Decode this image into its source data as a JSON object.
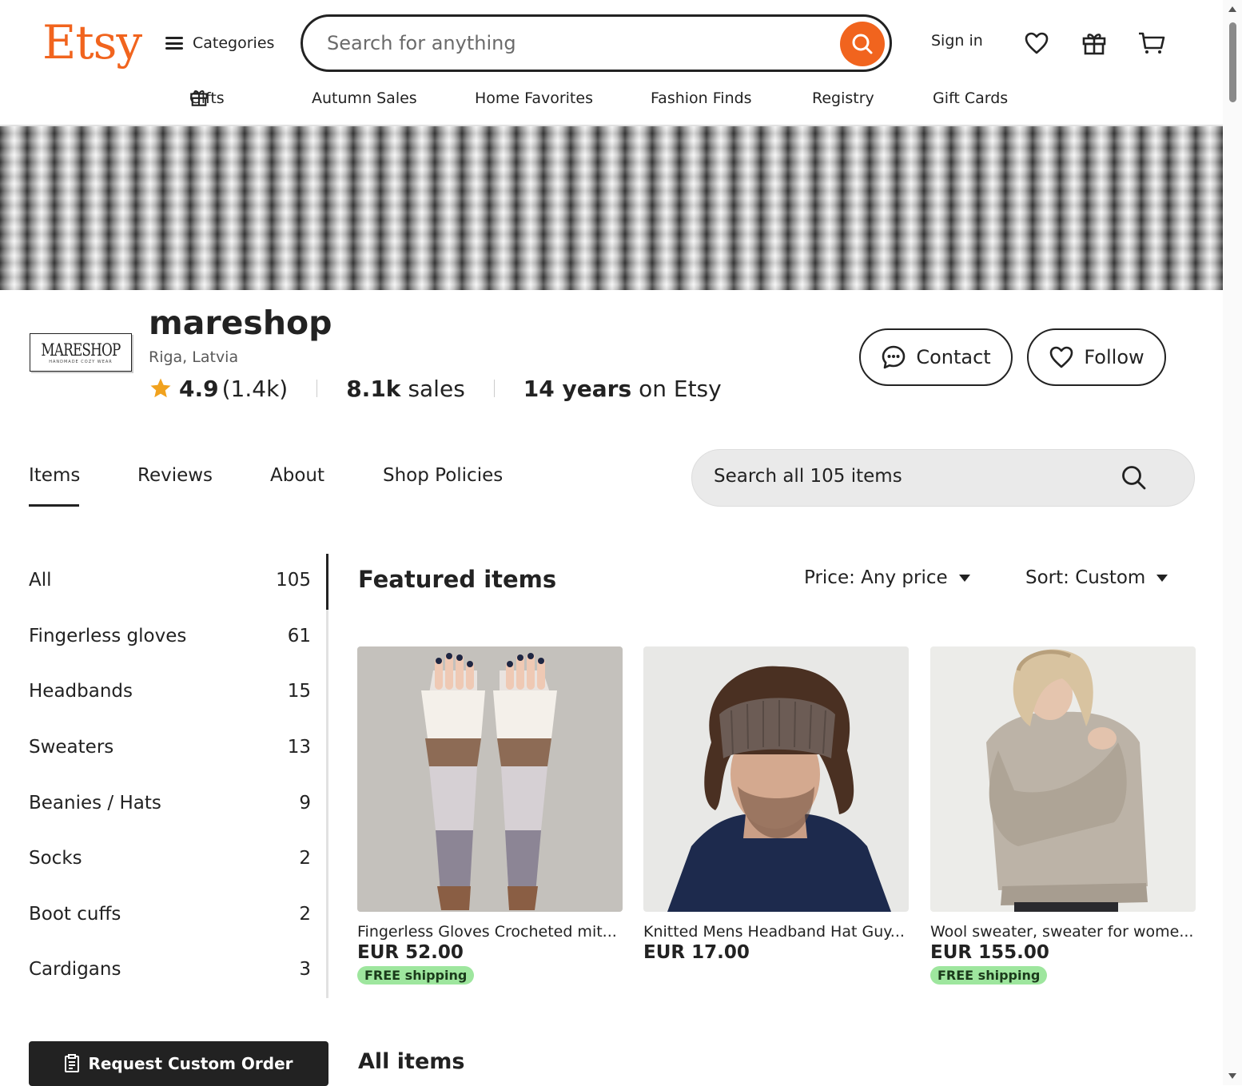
{
  "header": {
    "logo": "Etsy",
    "categories_label": "Categories",
    "search_placeholder": "Search for anything",
    "signin_label": "Sign in",
    "icons": [
      "search-icon",
      "heart-icon",
      "gift-icon",
      "cart-icon"
    ],
    "nav": [
      "Gifts",
      "Autumn Sales",
      "Home Favorites",
      "Fashion Finds",
      "Registry",
      "Gift Cards"
    ]
  },
  "shop": {
    "logo_text": "MARESHOP",
    "logo_subtext": "HANDMADE COZY WEAR",
    "name": "mareshop",
    "location": "Riga, Latvia",
    "rating": "4.9",
    "rating_count": "(1.4k)",
    "sales_value": "8.1k",
    "sales_label": "sales",
    "years_value": "14 years",
    "years_label": "on Etsy",
    "contact_label": "Contact",
    "follow_label": "Follow"
  },
  "tabs": [
    "Items",
    "Reviews",
    "About",
    "Shop Policies"
  ],
  "shop_search_placeholder": "Search all 105 items",
  "sidebar": {
    "categories": [
      {
        "label": "All",
        "count": "105"
      },
      {
        "label": "Fingerless gloves",
        "count": "61"
      },
      {
        "label": "Headbands",
        "count": "15"
      },
      {
        "label": "Sweaters",
        "count": "13"
      },
      {
        "label": "Beanies / Hats",
        "count": "9"
      },
      {
        "label": "Socks",
        "count": "2"
      },
      {
        "label": "Boot cuffs",
        "count": "2"
      },
      {
        "label": "Cardigans",
        "count": "3"
      }
    ],
    "custom_order_label": "Request Custom Order"
  },
  "main": {
    "featured_title": "Featured items",
    "price_filter": "Price: Any price",
    "sort_filter": "Sort: Custom",
    "items": [
      {
        "title": "Fingerless Gloves Crocheted mit...",
        "price": "EUR 52.00",
        "shipping": "FREE shipping"
      },
      {
        "title": "Knitted Mens Headband Hat Guy...",
        "price": "EUR 17.00",
        "shipping": ""
      },
      {
        "title": "Wool sweater, sweater for wome...",
        "price": "EUR 155.00",
        "shipping": "FREE shipping"
      }
    ],
    "all_items_title": "All items"
  },
  "colors": {
    "brand": "#f1641e",
    "free_shipping_bg": "#9ee69e",
    "star": "#f1a21e"
  }
}
